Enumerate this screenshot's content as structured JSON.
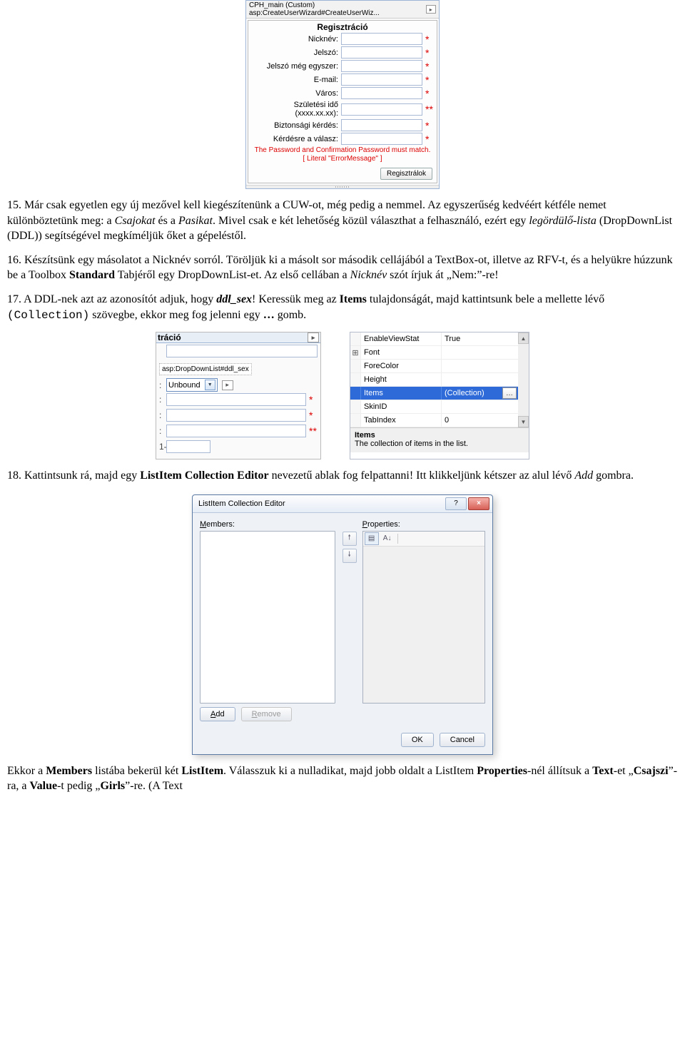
{
  "fig1": {
    "design_title": "CPH_main (Custom)  asp:CreateUserWizard#CreateUserWiz...",
    "heading": "Regisztráció",
    "rows": [
      {
        "label": "Nicknév:",
        "star": "*"
      },
      {
        "label": "Jelszó:",
        "star": "*"
      },
      {
        "label": "Jelszó még egyszer:",
        "star": "*"
      },
      {
        "label": "E-mail:",
        "star": "*"
      },
      {
        "label": "Város:",
        "star": "*"
      },
      {
        "label": "Születési idő (xxxx.xx.xx):",
        "star": "**"
      },
      {
        "label": "Biztonsági kérdés:",
        "star": "*"
      },
      {
        "label": "Kérdésre a válasz:",
        "star": "*"
      }
    ],
    "err1": "The Password and Confirmation Password must match.",
    "err2": "[ Literal \"ErrorMessage\" ]",
    "button": "Regisztrálok"
  },
  "para15_a": "15.  Már csak egyetlen egy új mezővel kell kiegészítenünk a CUW-ot, még pedig a nemmel. Az egyszerűség kedvéért kétféle nemet különböztetünk meg: a ",
  "para15_csajokat": "Csajokat",
  "para15_mid": " és a ",
  "para15_pasikat": "Pasikat",
  "para15_b": ". Mivel csak e két lehetőség közül választhat a felhasználó, ezért egy ",
  "para15_legordulo": "legördülő-lista",
  "para15_c": " (DropDownList (DDL)) segítségével megkíméljük őket a gépeléstől.",
  "para16_a": "16.  Készítsünk egy másolatot a Nicknév sorról. Töröljük ki a másolt sor második cellájából a TextBox-ot, illetve az RFV-t, és a helyükre húzzunk be a Toolbox ",
  "para16_standard": "Standard",
  "para16_b": " Tabjéről egy DropDownList-et. Az első cellában a ",
  "para16_nicknev": "Nicknév",
  "para16_c": " szót írjuk át „Nem:”-re!",
  "para17_a": "17.  A DDL-nek azt az azonosítót adjuk, hogy ",
  "para17_ddlsex": "ddl_sex",
  "para17_b": "! Keressük meg az ",
  "para17_items": "Items",
  "para17_c": " tulajdonságát, majd kattintsunk bele a mellette lévő ",
  "para17_collection": "(Collection)",
  "para17_d": " szövegbe, ekkor meg fog jelenni egy ",
  "para17_dots": "…",
  "para17_e": " gomb.",
  "fig2a": {
    "top": "tráció",
    "tag": "asp:DropDownList#ddl_sex",
    "ddl_text": "Unbound",
    "stars": [
      "*",
      "*",
      "**"
    ]
  },
  "fig2b": {
    "rows": [
      {
        "expander": "",
        "name": "EnableViewStat",
        "val": "True"
      },
      {
        "expander": "⊞",
        "name": "Font",
        "val": ""
      },
      {
        "expander": "",
        "name": "ForeColor",
        "val": ""
      },
      {
        "expander": "",
        "name": "Height",
        "val": ""
      },
      {
        "expander": "",
        "name": "Items",
        "val": "(Collection)",
        "selected": true,
        "ellipsis": true
      },
      {
        "expander": "",
        "name": "SkinID",
        "val": ""
      },
      {
        "expander": "",
        "name": "TabIndex",
        "val": "0"
      }
    ],
    "desc_title": "Items",
    "desc_text": "The collection of items in the list."
  },
  "para18_a": "18.  Kattintsunk rá, majd egy ",
  "para18_editor": "ListItem Collection Editor",
  "para18_b": " nevezetű ablak fog felpattanni! Itt klikkeljünk kétszer az alul lévő ",
  "para18_add": "Add",
  "para18_c": " gombra.",
  "fig3": {
    "title": "ListItem Collection Editor",
    "members_label_pre": "M",
    "members_label_post": "embers:",
    "props_label_pre": "P",
    "props_label_post": "roperties:",
    "add": "Add",
    "remove": "Remove",
    "ok": "OK",
    "cancel": "Cancel",
    "question": "?",
    "close": "×",
    "up": "🠕",
    "down": "🠗"
  },
  "paraEnd_a": "Ekkor a ",
  "paraEnd_members": "Members",
  "paraEnd_b": " listába bekerül két ",
  "paraEnd_listitem": "ListItem",
  "paraEnd_c": ". Válasszuk ki a nulladikat, majd jobb oldalt a ListItem ",
  "paraEnd_properties": "Properties",
  "paraEnd_d": "-nél állítsuk a ",
  "paraEnd_text": "Text",
  "paraEnd_e": "-et „",
  "paraEnd_csajszi": "Csajszi",
  "paraEnd_f": "”-ra, a ",
  "paraEnd_value": "Value",
  "paraEnd_g": "-t pedig „",
  "paraEnd_girls": "Girls",
  "paraEnd_h": "”-re. (A Text"
}
